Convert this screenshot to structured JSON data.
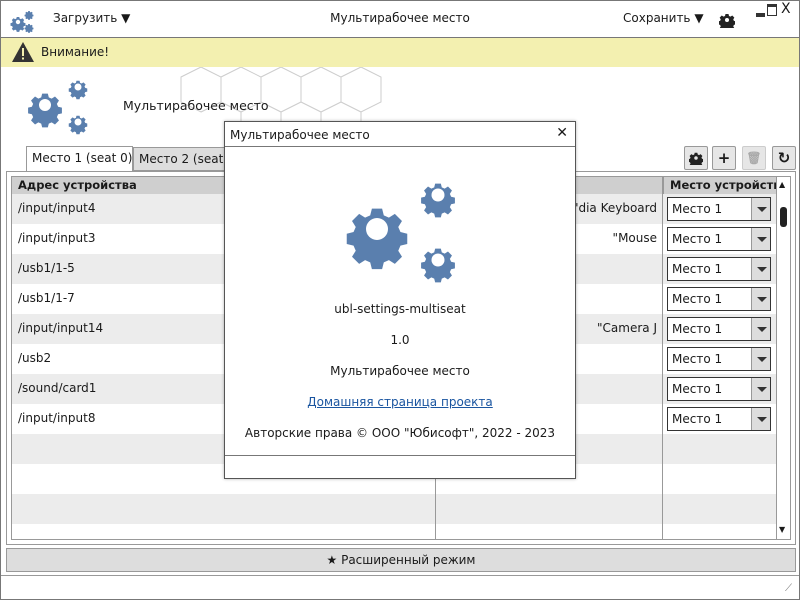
{
  "titlebar": {
    "load_label": "Загрузить",
    "title": "Мультирабочее место",
    "save_label": "Сохранить"
  },
  "warning": {
    "text": "Внимание!"
  },
  "banner": {
    "title": "Мультирабочее место"
  },
  "tabs": [
    {
      "label": "Место 1 (seat 0)"
    },
    {
      "label": "Место 2 (seat 1)"
    }
  ],
  "table": {
    "headers": [
      "Адрес устройства",
      "",
      "Место устройства"
    ],
    "rows": [
      {
        "address": "/input/input4",
        "name": "dia Keyboard\"",
        "seat": "Место 1"
      },
      {
        "address": "/input/input3",
        "name": "Mouse\"",
        "seat": "Место 1"
      },
      {
        "address": "/usb1/1-5",
        "name": "",
        "seat": "Место 1"
      },
      {
        "address": "/usb1/1-7",
        "name": "",
        "seat": "Место 1"
      },
      {
        "address": "/input/input14",
        "name": "Camera J\"",
        "seat": "Место 1"
      },
      {
        "address": "/usb2",
        "name": "",
        "seat": "Место 1"
      },
      {
        "address": "/sound/card1",
        "name": "",
        "seat": "Место 1"
      },
      {
        "address": "/input/input8",
        "name": "",
        "seat": "Место 1"
      }
    ]
  },
  "advanced_label": "Расширенный режим",
  "dialog": {
    "title": "Мультирабочее место",
    "app_name": "ubl-settings-multiseat",
    "version": "1.0",
    "description": "Мультирабочее место",
    "link": "Домашняя страница проекта",
    "copyright": "Авторские права © ООО \"Юбисофт\", 2022 - 2023"
  },
  "colors": {
    "accent": "#5a7fae",
    "warning_bg": "#f3f0b0",
    "link": "#1a55a0"
  }
}
